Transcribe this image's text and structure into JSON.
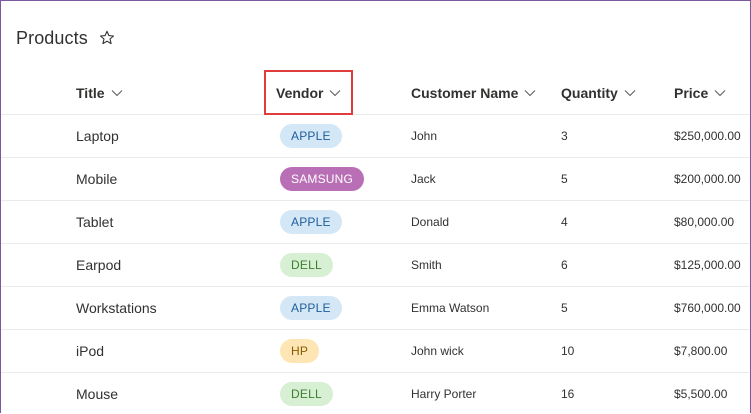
{
  "list": {
    "title": "Products"
  },
  "columns": [
    {
      "label": "Title"
    },
    {
      "label": "Vendor"
    },
    {
      "label": "Customer Name"
    },
    {
      "label": "Quantity"
    },
    {
      "label": "Price"
    }
  ],
  "vendor_colors": {
    "APPLE": {
      "bg": "#d4e7f7",
      "fg": "#1f5e9b"
    },
    "SAMSUNG": {
      "bg": "#b96fb5",
      "fg": "#ffffff"
    },
    "DELL": {
      "bg": "#d7f0d3",
      "fg": "#3f7d33"
    },
    "HP": {
      "bg": "#fde6b3",
      "fg": "#8a5a00"
    }
  },
  "rows": [
    {
      "title": "Laptop",
      "vendor": "APPLE",
      "customer": "John",
      "quantity": "3",
      "price": "$250,000.00"
    },
    {
      "title": "Mobile",
      "vendor": "SAMSUNG",
      "customer": "Jack",
      "quantity": "5",
      "price": "$200,000.00"
    },
    {
      "title": "Tablet",
      "vendor": "APPLE",
      "customer": "Donald",
      "quantity": "4",
      "price": "$80,000.00"
    },
    {
      "title": "Earpod",
      "vendor": "DELL",
      "customer": "Smith",
      "quantity": "6",
      "price": "$125,000.00"
    },
    {
      "title": "Workstations",
      "vendor": "APPLE",
      "customer": "Emma Watson",
      "quantity": "5",
      "price": "$760,000.00"
    },
    {
      "title": "iPod",
      "vendor": "HP",
      "customer": "John wick",
      "quantity": "10",
      "price": "$7,800.00"
    },
    {
      "title": "Mouse",
      "vendor": "DELL",
      "customer": "Harry Porter",
      "quantity": "16",
      "price": "$5,500.00"
    }
  ]
}
